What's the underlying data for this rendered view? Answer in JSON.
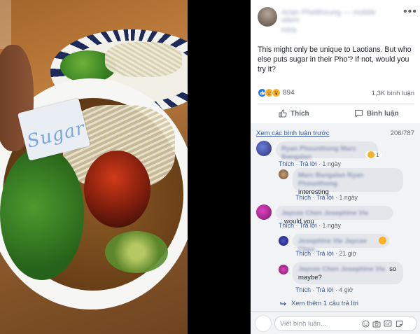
{
  "photo": {
    "packet_text": "Sugar"
  },
  "post": {
    "author": "Arian Phetthoung — mobile wlem",
    "author_line2": "intra",
    "text": "This might only be unique to Laotians. But who else puts sugar in their Pho'? If not, would you try it?",
    "reaction_count": "894",
    "share_text": "1,3K bình luận",
    "like_label": "Thích",
    "comment_label": "Bình luận"
  },
  "comments": {
    "prev_link": "Xem các bình luận trước",
    "count": "206/787",
    "items": [
      {
        "name": "Ryan Phounthong Marc Bangalan",
        "text": "",
        "reaction": "1",
        "like": "Thích",
        "reply": "Trả lời",
        "time": "1 ngày"
      },
      {
        "name": "Marc Bangalan Ryan Phounthong",
        "text": "interesting",
        "like": "Thích",
        "reply": "Trả lời",
        "time": "1 ngày"
      },
      {
        "name": "Jaycee Chen Josephine Vie",
        "text": "would you",
        "like": "Thích",
        "reply": "Trả lời",
        "time": "1 ngày"
      },
      {
        "name": "Josephine Vie Jaycee Chen",
        "text": "",
        "like": "Thích",
        "reply": "Trả lời",
        "time": "21 giờ"
      },
      {
        "name": "Jaycee Chen Josephine Vie",
        "text": "so maybe?",
        "like": "Thích",
        "reply": "Trả lời",
        "time": "4 giờ"
      }
    ],
    "more_replies": "Xem thêm 1 câu trả lời"
  },
  "composer": {
    "placeholder": "Viết bình luận..."
  },
  "colors": {
    "link": "#385898",
    "like": "#1877f2",
    "bubble": "#e4e6eb"
  }
}
